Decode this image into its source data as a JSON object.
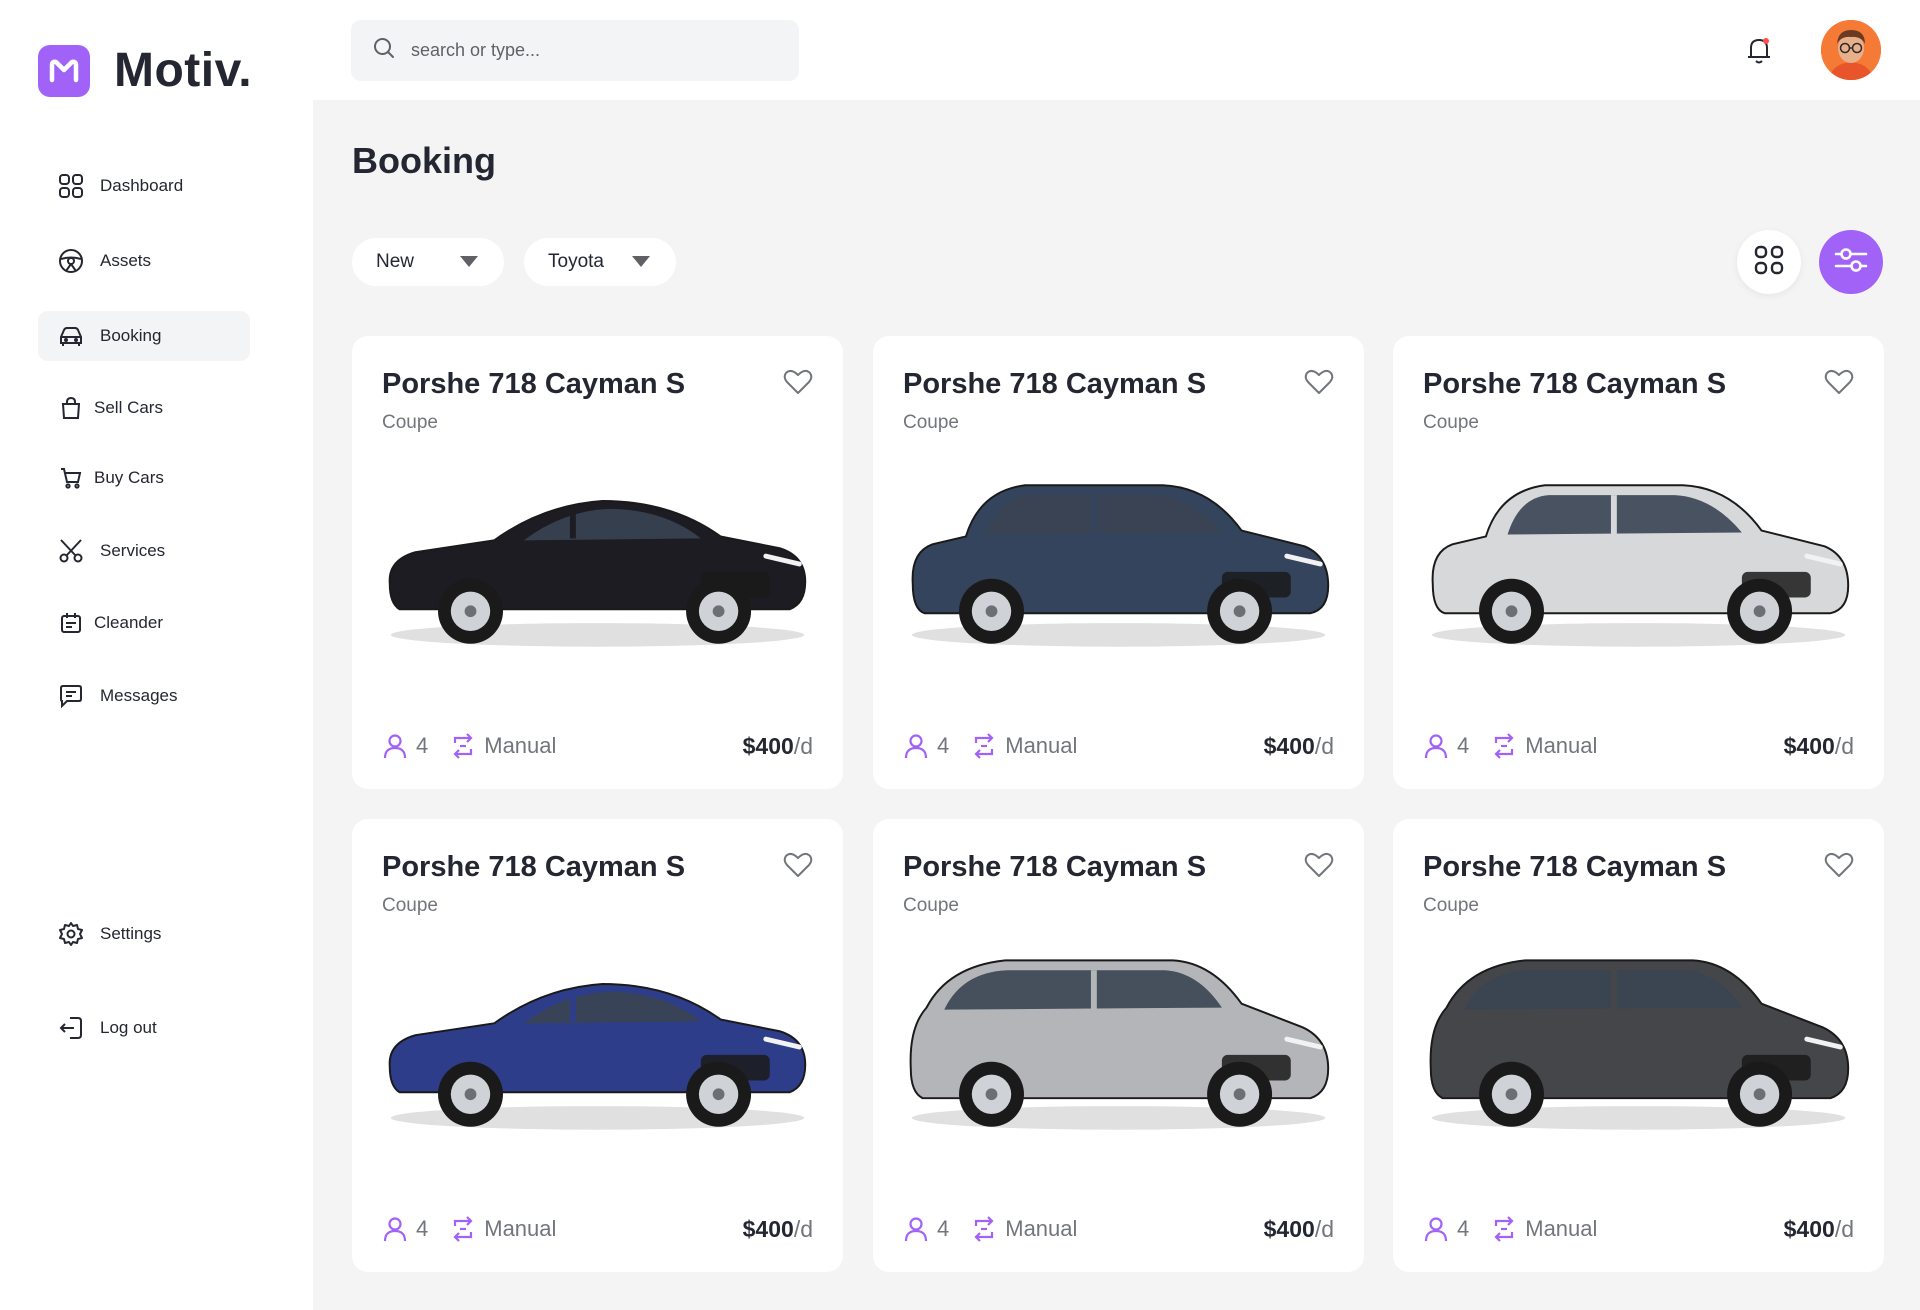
{
  "brand": {
    "name": "Motiv.",
    "accent": "#a162f7"
  },
  "sidebar": {
    "items": [
      {
        "label": "Dashboard",
        "icon": "dashboard-grid-icon",
        "active": false
      },
      {
        "label": "Assets",
        "icon": "steering-wheel-icon",
        "active": false
      },
      {
        "label": "Booking",
        "icon": "car-icon",
        "active": true
      },
      {
        "label": "Sell Cars",
        "icon": "shopping-bag-icon",
        "active": false
      },
      {
        "label": "Buy Cars",
        "icon": "shopping-cart-icon",
        "active": false
      },
      {
        "label": "Services",
        "icon": "scissors-icon",
        "active": false
      },
      {
        "label": "Cleander",
        "icon": "calendar-icon",
        "active": false
      },
      {
        "label": "Messages",
        "icon": "message-icon",
        "active": false
      }
    ],
    "settings_label": "Settings",
    "logout_label": "Log out"
  },
  "search": {
    "placeholder": "search or type..."
  },
  "main": {
    "title": "Booking",
    "filters": [
      {
        "label": "New"
      },
      {
        "label": "Toyota"
      }
    ]
  },
  "cards": [
    {
      "title": "Porshe 718 Cayman S",
      "type": "Coupe",
      "seats": "4",
      "transmission": "Manual",
      "price": "$400",
      "unit": "/d",
      "car_color": "#1c1c22",
      "style": "sedan"
    },
    {
      "title": "Porshe 718 Cayman S",
      "type": "Coupe",
      "seats": "4",
      "transmission": "Manual",
      "price": "$400",
      "unit": "/d",
      "car_color": "#34445c",
      "style": "suv"
    },
    {
      "title": "Porshe 718 Cayman S",
      "type": "Coupe",
      "seats": "4",
      "transmission": "Manual",
      "price": "$400",
      "unit": "/d",
      "car_color": "#d6d8da",
      "style": "suv"
    },
    {
      "title": "Porshe 718 Cayman S",
      "type": "Coupe",
      "seats": "4",
      "transmission": "Manual",
      "price": "$400",
      "unit": "/d",
      "car_color": "#2e3d8a",
      "style": "sedan"
    },
    {
      "title": "Porshe 718 Cayman S",
      "type": "Coupe",
      "seats": "4",
      "transmission": "Manual",
      "price": "$400",
      "unit": "/d",
      "car_color": "#b4b5b8",
      "style": "mpv"
    },
    {
      "title": "Porshe 718 Cayman S",
      "type": "Coupe",
      "seats": "4",
      "transmission": "Manual",
      "price": "$400",
      "unit": "/d",
      "car_color": "#45464a",
      "style": "mpv"
    }
  ]
}
